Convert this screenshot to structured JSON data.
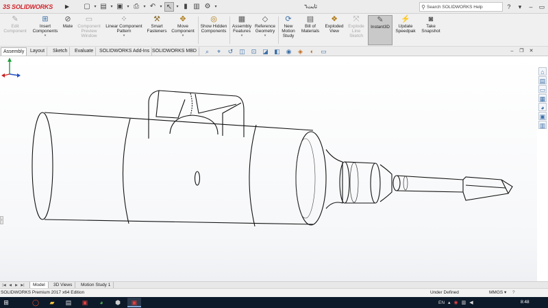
{
  "app": {
    "brand_mark": "3S",
    "brand_name": "SOLIDWORKS",
    "document_title": "ثابت٦",
    "search_placeholder": "Search SOLIDWORKS Help"
  },
  "quick_access": [
    {
      "name": "new-document-icon",
      "glyph": "▢"
    },
    {
      "name": "dropdown-arrow-icon",
      "glyph": "▾"
    },
    {
      "name": "open-document-icon",
      "glyph": "▤"
    },
    {
      "name": "dropdown-arrow-icon",
      "glyph": "▾"
    },
    {
      "name": "save-icon",
      "glyph": "▣"
    },
    {
      "name": "dropdown-arrow-icon",
      "glyph": "▾"
    },
    {
      "name": "print-icon",
      "glyph": "⎙"
    },
    {
      "name": "dropdown-arrow-icon",
      "glyph": "▾"
    },
    {
      "name": "undo-icon",
      "glyph": "↶"
    },
    {
      "name": "dropdown-arrow-icon",
      "glyph": "▾"
    },
    {
      "name": "select-pointer-icon",
      "glyph": "↖"
    },
    {
      "name": "dropdown-arrow-icon",
      "glyph": "▾"
    },
    {
      "name": "rebuild-icon",
      "glyph": "▮"
    },
    {
      "name": "file-properties-icon",
      "glyph": "▥"
    },
    {
      "name": "options-gear-icon",
      "glyph": "⚙"
    },
    {
      "name": "dropdown-arrow-icon",
      "glyph": "▾"
    }
  ],
  "window_controls": {
    "help": "?",
    "help_arrow": "▾",
    "minimize": "–",
    "restore": "▭",
    "close": "✕"
  },
  "ribbon": {
    "edit_component": "Edit Component",
    "insert_components": "Insert Components",
    "mate": "Mate",
    "component_preview": "Component Preview Window",
    "linear_pattern": "Linear Component Pattern",
    "smart_fasteners": "Smart Fasteners",
    "move_component": "Move Component",
    "show_hidden": "Show Hidden Components",
    "assembly_features": "Assembly Features",
    "reference_geometry": "Reference Geometry",
    "new_motion_study": "New Motion Study",
    "bill_of_materials": "Bill of Materials",
    "exploded_view": "Exploded View",
    "explode_line_sketch": "Explode Line Sketch",
    "instant3d": "Instant3D",
    "update_speedpak": "Update Speedpak",
    "take_snapshot": "Take Snapshot"
  },
  "command_tabs": [
    {
      "label": "Assembly",
      "active": true
    },
    {
      "label": "Layout",
      "active": false
    },
    {
      "label": "Sketch",
      "active": false
    },
    {
      "label": "Evaluate",
      "active": false
    },
    {
      "label": "SOLIDWORKS Add-Ins",
      "active": false
    },
    {
      "label": "SOLIDWORKS MBD",
      "active": false
    }
  ],
  "bottom_tabs": [
    {
      "label": "Model",
      "active": true
    },
    {
      "label": "3D Views",
      "active": false
    },
    {
      "label": "Motion Study 1",
      "active": false
    }
  ],
  "status": {
    "edition": "SOLIDWORKS Premium 2017 x64 Edition",
    "definition": "Under Defined",
    "units": "MMGS",
    "units_arrow": "▾",
    "help": "?"
  },
  "taskbar": {
    "language": "EN",
    "time": "8:48"
  },
  "colors": {
    "brand_red": "#d2232a",
    "taskbar_bg": "#0d1a2a",
    "model_edge": "#111111",
    "triad_green": "#1f9d3a",
    "triad_blue": "#1f4fc4",
    "triad_red": "#cc2222"
  }
}
